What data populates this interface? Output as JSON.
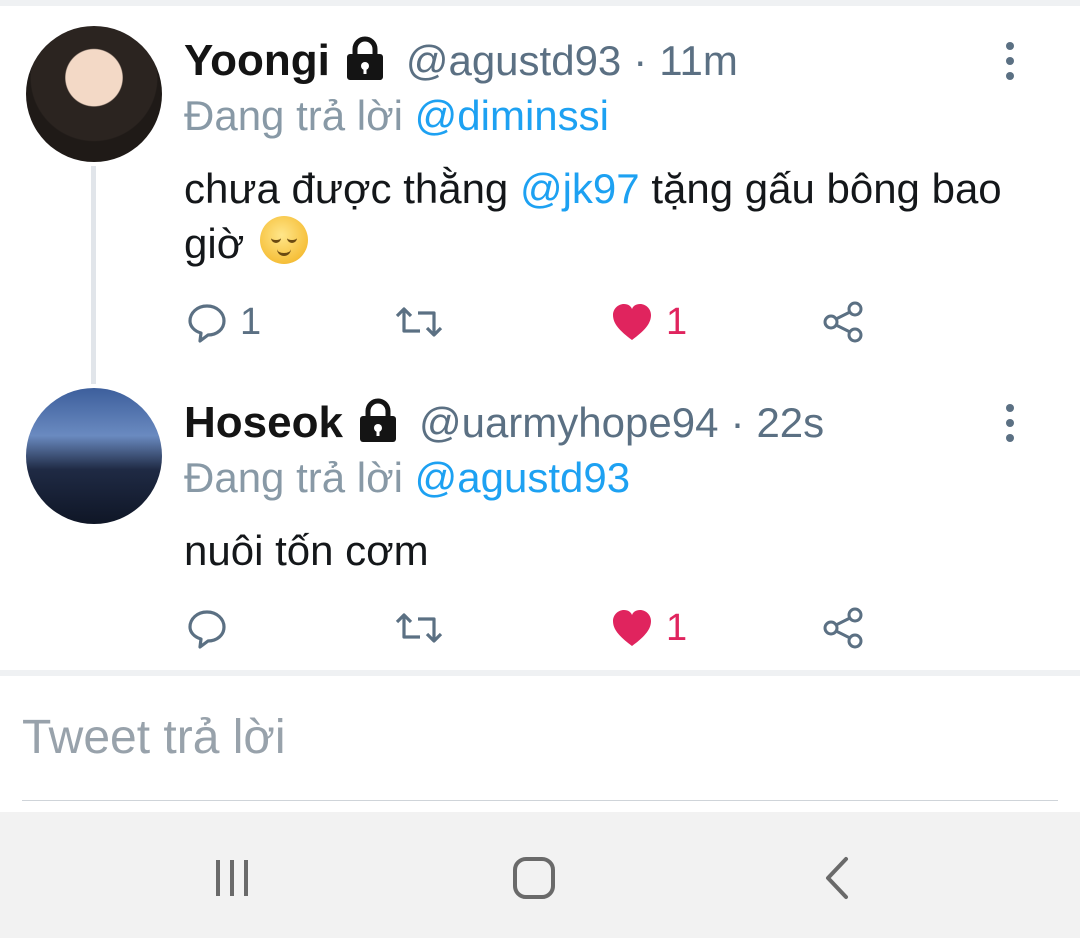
{
  "tweets": [
    {
      "name": "Yoongi",
      "handle": "@agustd93",
      "separator": "·",
      "time": "11m",
      "reply_prefix": "Đang trả lời",
      "reply_to": "@diminssi",
      "text_before": "chưa được thằng",
      "text_mention": "@jk97",
      "text_after": "tặng gấu bông bao giờ",
      "emoji": "relieved-face",
      "reply_count": "1",
      "retweet_count": "",
      "like_count": "1",
      "liked": true
    },
    {
      "name": "Hoseok",
      "handle": "@uarmyhope94",
      "separator": "·",
      "time": "22s",
      "reply_prefix": "Đang trả lời",
      "reply_to": "@agustd93",
      "text": "nuôi tốn cơm",
      "reply_count": "",
      "retweet_count": "",
      "like_count": "1",
      "liked": true
    }
  ],
  "composer": {
    "placeholder": "Tweet trả lời"
  },
  "navbar": {
    "buttons": [
      "recent-apps",
      "home",
      "back"
    ]
  },
  "colors": {
    "link": "#1da1f2",
    "like": "#e0245e",
    "muted": "#5b7083"
  }
}
